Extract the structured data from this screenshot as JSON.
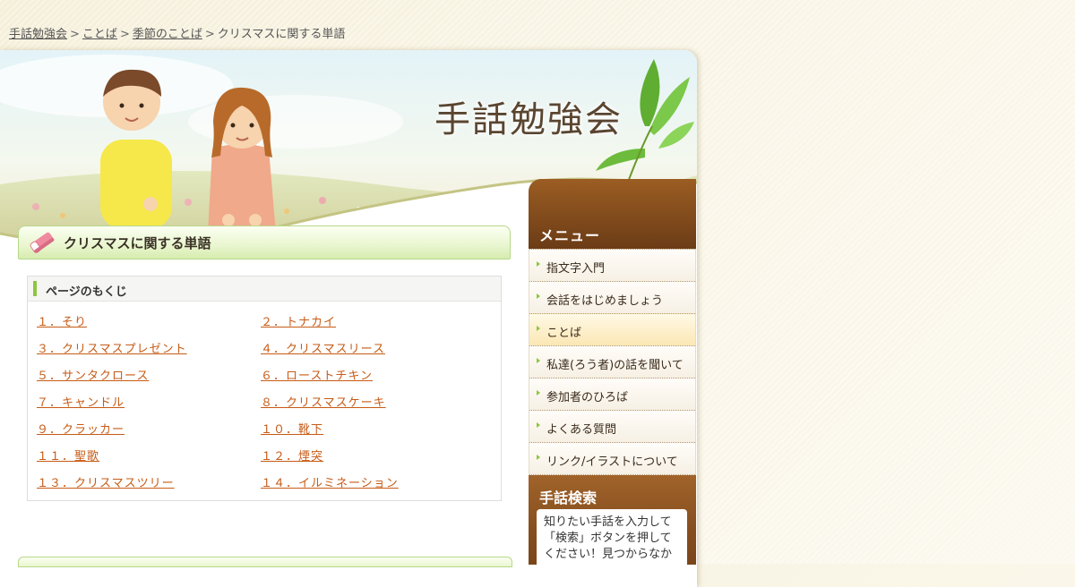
{
  "breadcrumb": {
    "items": [
      "手話勉強会",
      "ことば",
      "季節のことば"
    ],
    "current": "クリスマスに関する単語",
    "separator": ">"
  },
  "header": {
    "site_title": "手話勉強会"
  },
  "main": {
    "title": "クリスマスに関する単語",
    "toc": {
      "heading": "ページのもくじ",
      "items": [
        "１．そり",
        "２．トナカイ",
        "３．クリスマスプレゼント",
        "４．クリスマスリース",
        "５．サンタクロース",
        "６．ローストチキン",
        "７．キャンドル",
        "８．クリスマスケーキ",
        "９．クラッカー",
        "１０．靴下",
        "１１．聖歌",
        "１２．煙突",
        "１３．クリスマスツリー",
        "１４．イルミネーション"
      ]
    }
  },
  "sidebar": {
    "menu_heading": "メニュー",
    "menu_items": [
      "指文字入門",
      "会話をはじめましょう",
      "ことば",
      "私達(ろう者)の話を聞いて",
      "参加者のひろば",
      "よくある質問",
      "リンク/イラストについて"
    ],
    "active_index": 2,
    "search": {
      "heading": "手話検索",
      "description": "知りたい手話を入力して「検索」ボタンを押してください！見つからなか"
    }
  },
  "colors": {
    "link": "#c65b16",
    "menu_brown": "#7a461a",
    "accent_green": "#8cc63f"
  }
}
